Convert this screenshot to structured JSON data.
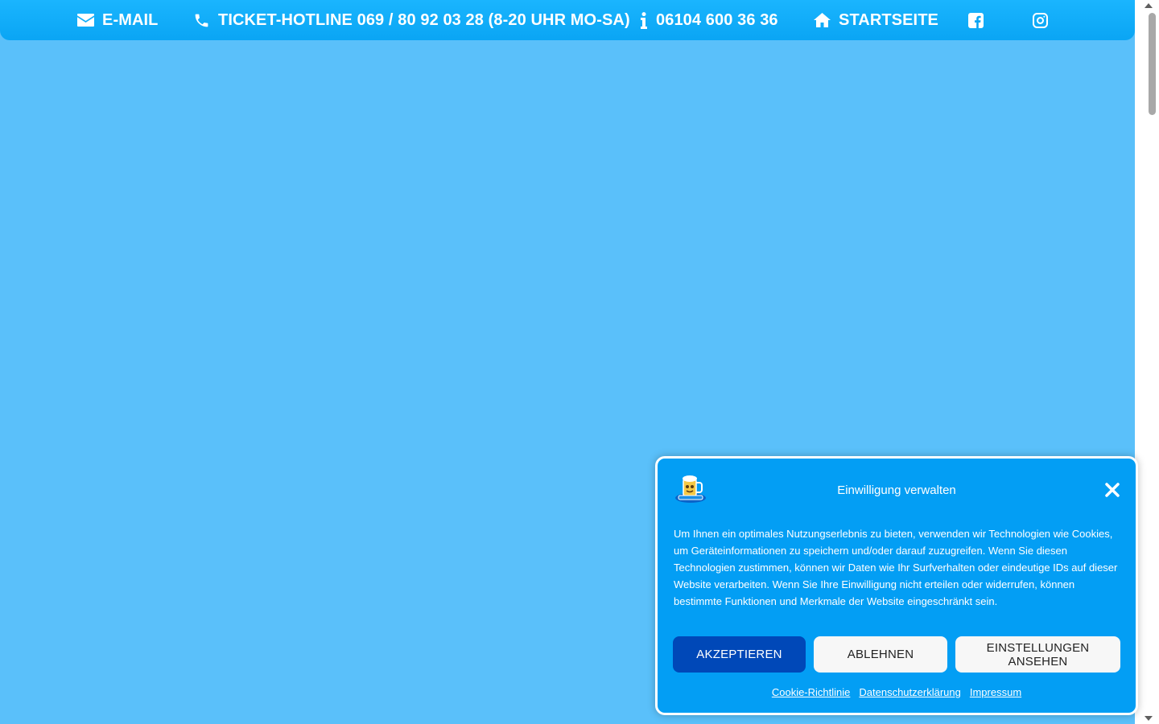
{
  "nav": {
    "email_label": "E-MAIL",
    "hotline_label": "TICKET-HOTLINE 069 / 80 92 03 28 (8-20 UHR MO-SA)",
    "info_label": "06104 600 36 36",
    "home_label": "STARTSEITE",
    "icons": [
      "envelope-icon",
      "phone-icon",
      "info-icon",
      "home-icon",
      "facebook-icon",
      "instagram-icon"
    ]
  },
  "consent": {
    "title": "Einwilligung verwalten",
    "text": "Um Ihnen ein optimales Nutzungserlebnis zu bieten, verwenden wir Technologien wie Cookies, um Geräteinformationen zu speichern und/oder darauf zuzugreifen. Wenn Sie diesen Technologien zustimmen, können wir Daten wie Ihr Surfverhalten oder eindeutige IDs auf dieser Website verarbeiten. Wenn Sie Ihre Einwilligung nicht erteilen oder widerrufen, können bestimmte Funktionen und Merkmale der Website eingeschränkt sein.",
    "accept_label": "AKZEPTIEREN",
    "deny_label": "ABLEHNEN",
    "preferences_label": "EINSTELLUNGEN ANSEHEN",
    "links": {
      "cookie_policy": "Cookie-Richtlinie",
      "privacy": "Datenschutzerklärung",
      "imprint": "Impressum"
    }
  },
  "colors": {
    "page_background": "#5ac0fa",
    "topbar": "#0aa5f4",
    "dialog_background": "#039ef4",
    "accept_button": "#0048b8",
    "secondary_button": "#f7f7f7"
  }
}
